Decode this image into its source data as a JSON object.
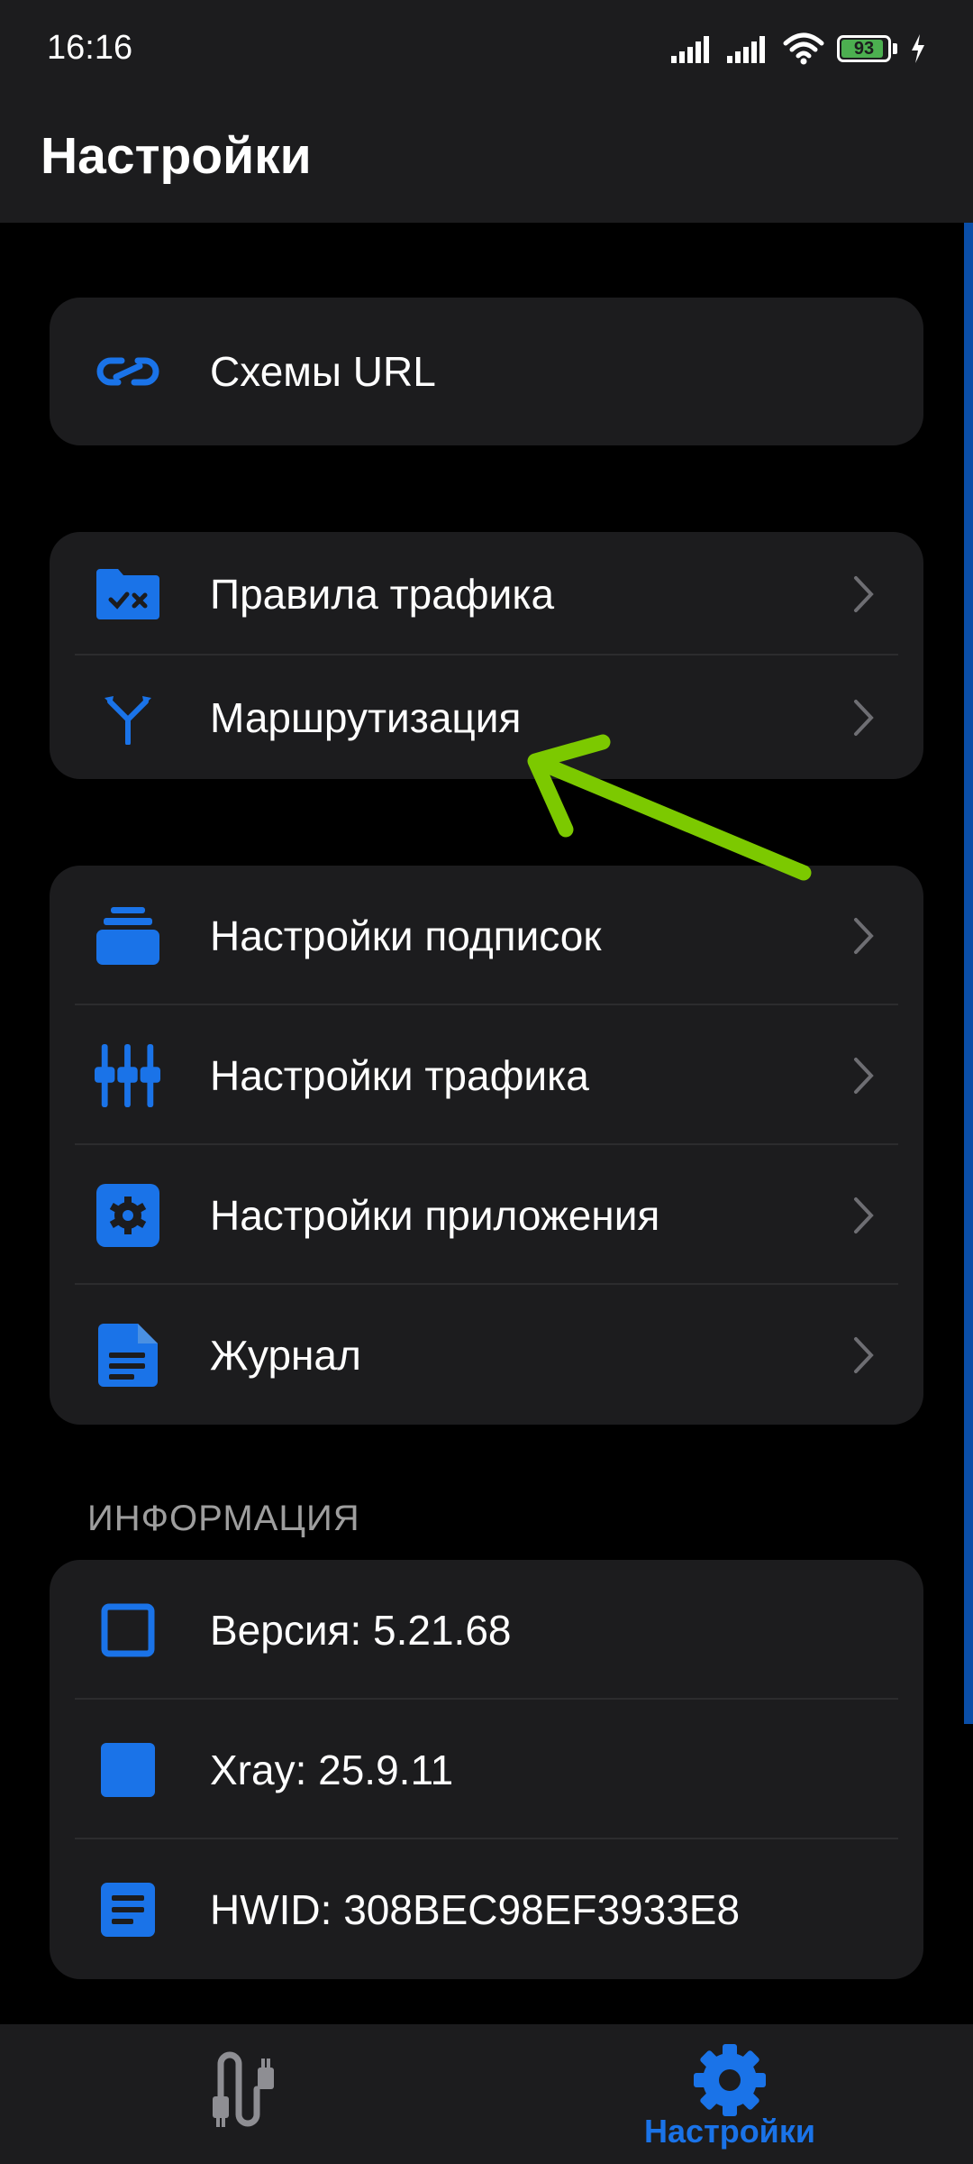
{
  "status_bar": {
    "time": "16:16",
    "battery_level": "93",
    "battery_fraction": 0.93,
    "icons": [
      "signal-icon",
      "signal-icon",
      "wifi-icon",
      "battery-icon",
      "charging-icon"
    ]
  },
  "header": {
    "title": "Настройки"
  },
  "groups": {
    "url": {
      "items": [
        {
          "label": "Схемы URL",
          "icon": "link-icon"
        }
      ]
    },
    "traffic": {
      "items": [
        {
          "label": "Правила трафика",
          "icon": "folder-rules-icon"
        },
        {
          "label": "Маршрутизация",
          "icon": "routing-icon"
        }
      ]
    },
    "settings": {
      "items": [
        {
          "label": "Настройки подписок",
          "icon": "subscriptions-icon"
        },
        {
          "label": "Настройки трафика",
          "icon": "sliders-icon"
        },
        {
          "label": "Настройки приложения",
          "icon": "gear-icon"
        },
        {
          "label": "Журнал",
          "icon": "document-icon"
        }
      ]
    },
    "info": {
      "section_label": "ИНФОРМАЦИЯ",
      "items": [
        {
          "label": "Версия: 5.21.68",
          "icon": "square-outline-icon"
        },
        {
          "label": "Xray: 25.9.11",
          "icon": "square-filled-icon"
        },
        {
          "label": "HWID: 308BEC98EF3933E8",
          "icon": "note-icon"
        }
      ]
    }
  },
  "bottom_nav": {
    "items": [
      {
        "label": "",
        "icon": "connection-cable-icon",
        "active": false
      },
      {
        "label": "Настройки",
        "icon": "gear-icon",
        "active": true
      }
    ]
  },
  "colors": {
    "accent": "#1a73e8",
    "card_background": "#1c1c1e",
    "page_background": "#000000",
    "annotation_arrow": "#7cc900"
  }
}
